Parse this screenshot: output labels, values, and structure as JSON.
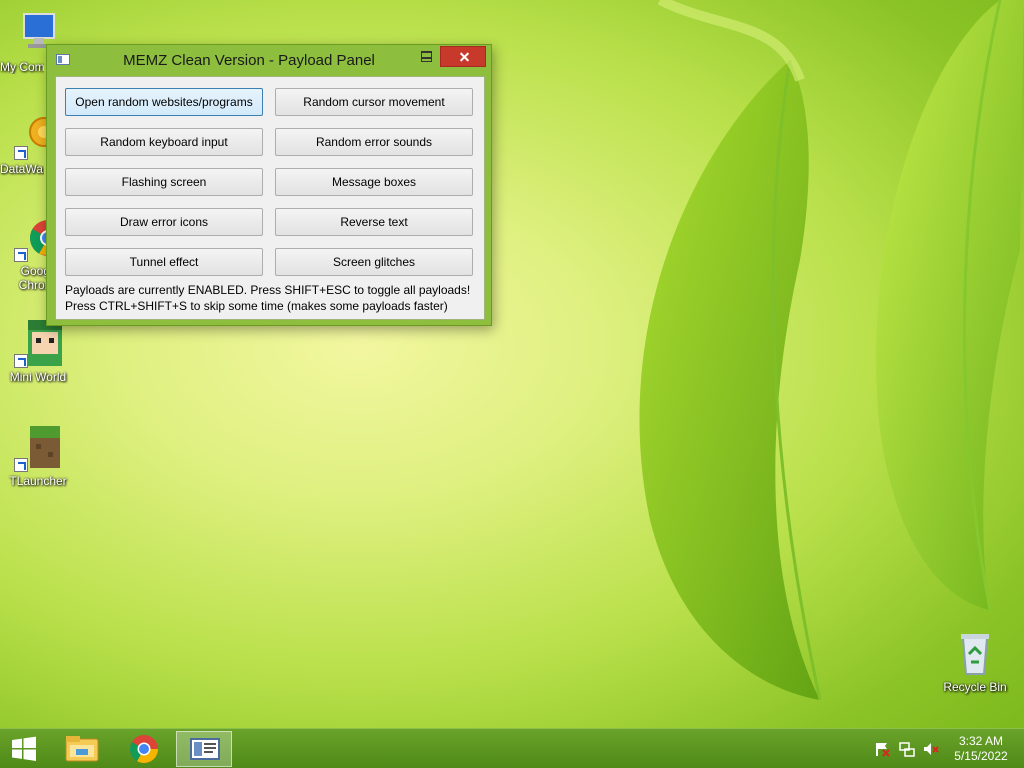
{
  "desktop": {
    "icons": [
      {
        "label": "My Computer"
      },
      {
        "label": "DataWarp"
      },
      {
        "label": "Google Chrome"
      },
      {
        "label": "Mini World"
      },
      {
        "label": "TLauncher"
      },
      {
        "label": "Recycle Bin"
      }
    ]
  },
  "window": {
    "title": "MEMZ Clean Version - Payload Panel",
    "buttons": [
      {
        "label": "Open random websites/programs",
        "selected": true
      },
      {
        "label": "Random cursor movement"
      },
      {
        "label": "Random keyboard input"
      },
      {
        "label": "Random error sounds"
      },
      {
        "label": "Flashing screen"
      },
      {
        "label": "Message boxes"
      },
      {
        "label": "Draw error icons"
      },
      {
        "label": "Reverse text"
      },
      {
        "label": "Tunnel effect"
      },
      {
        "label": "Screen glitches"
      }
    ],
    "status_line1": "Payloads are currently ENABLED. Press SHIFT+ESC to toggle all payloads!",
    "status_line2": "Press CTRL+SHIFT+S to skip some time (makes some payloads faster)"
  },
  "taskbar": {
    "items": [
      {
        "icon": "windows-start-icon"
      },
      {
        "icon": "file-explorer-icon"
      },
      {
        "icon": "chrome-icon"
      },
      {
        "icon": "memz-window-icon",
        "active": true
      }
    ],
    "clock_time": "3:32 AM",
    "clock_date": "5/15/2022"
  },
  "colors": {
    "taskbar": "#5a961f",
    "close_button": "#c7392b",
    "window_frame": "#8dbe3d",
    "selected_button_border": "#3c7fb1"
  }
}
